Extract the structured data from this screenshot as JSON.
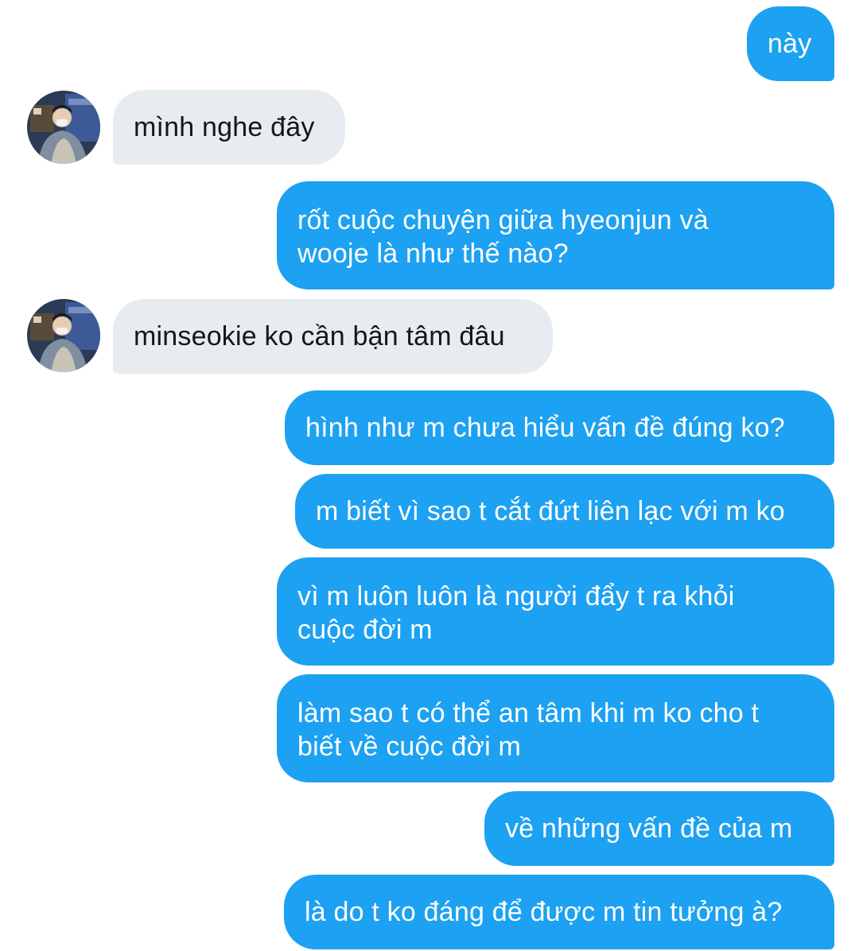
{
  "conversation": {
    "messages": [
      {
        "side": "out",
        "text": "này"
      },
      {
        "side": "in",
        "text": "mình nghe đây"
      },
      {
        "side": "out",
        "lines": [
          "rốt cuộc chuyện giữa hyeonjun và",
          "wooje là như thế nào?"
        ]
      },
      {
        "side": "in",
        "text": "minseokie ko cần bận tâm đâu"
      },
      {
        "side": "out",
        "text": "hình như m chưa hiểu vấn đề đúng ko?"
      },
      {
        "side": "out",
        "text": "m biết vì sao t cắt đứt liên lạc với m ko"
      },
      {
        "side": "out",
        "lines": [
          "vì m luôn luôn là người đẩy t ra khỏi",
          "cuộc đời m"
        ]
      },
      {
        "side": "out",
        "lines": [
          "làm sao t có thể an tâm khi m ko cho t",
          "biết về cuộc đời m"
        ]
      },
      {
        "side": "out",
        "text": "về những vấn đề của m"
      },
      {
        "side": "out",
        "text": "là do t ko đáng để được m tin tưởng à?"
      }
    ]
  },
  "colors": {
    "outgoing_bubble": "#1da1f2",
    "incoming_bubble": "#e6ecf0",
    "outgoing_text": "#ffffff",
    "incoming_text": "#14171a"
  },
  "icons": {
    "avatar": "user-avatar-photo"
  }
}
